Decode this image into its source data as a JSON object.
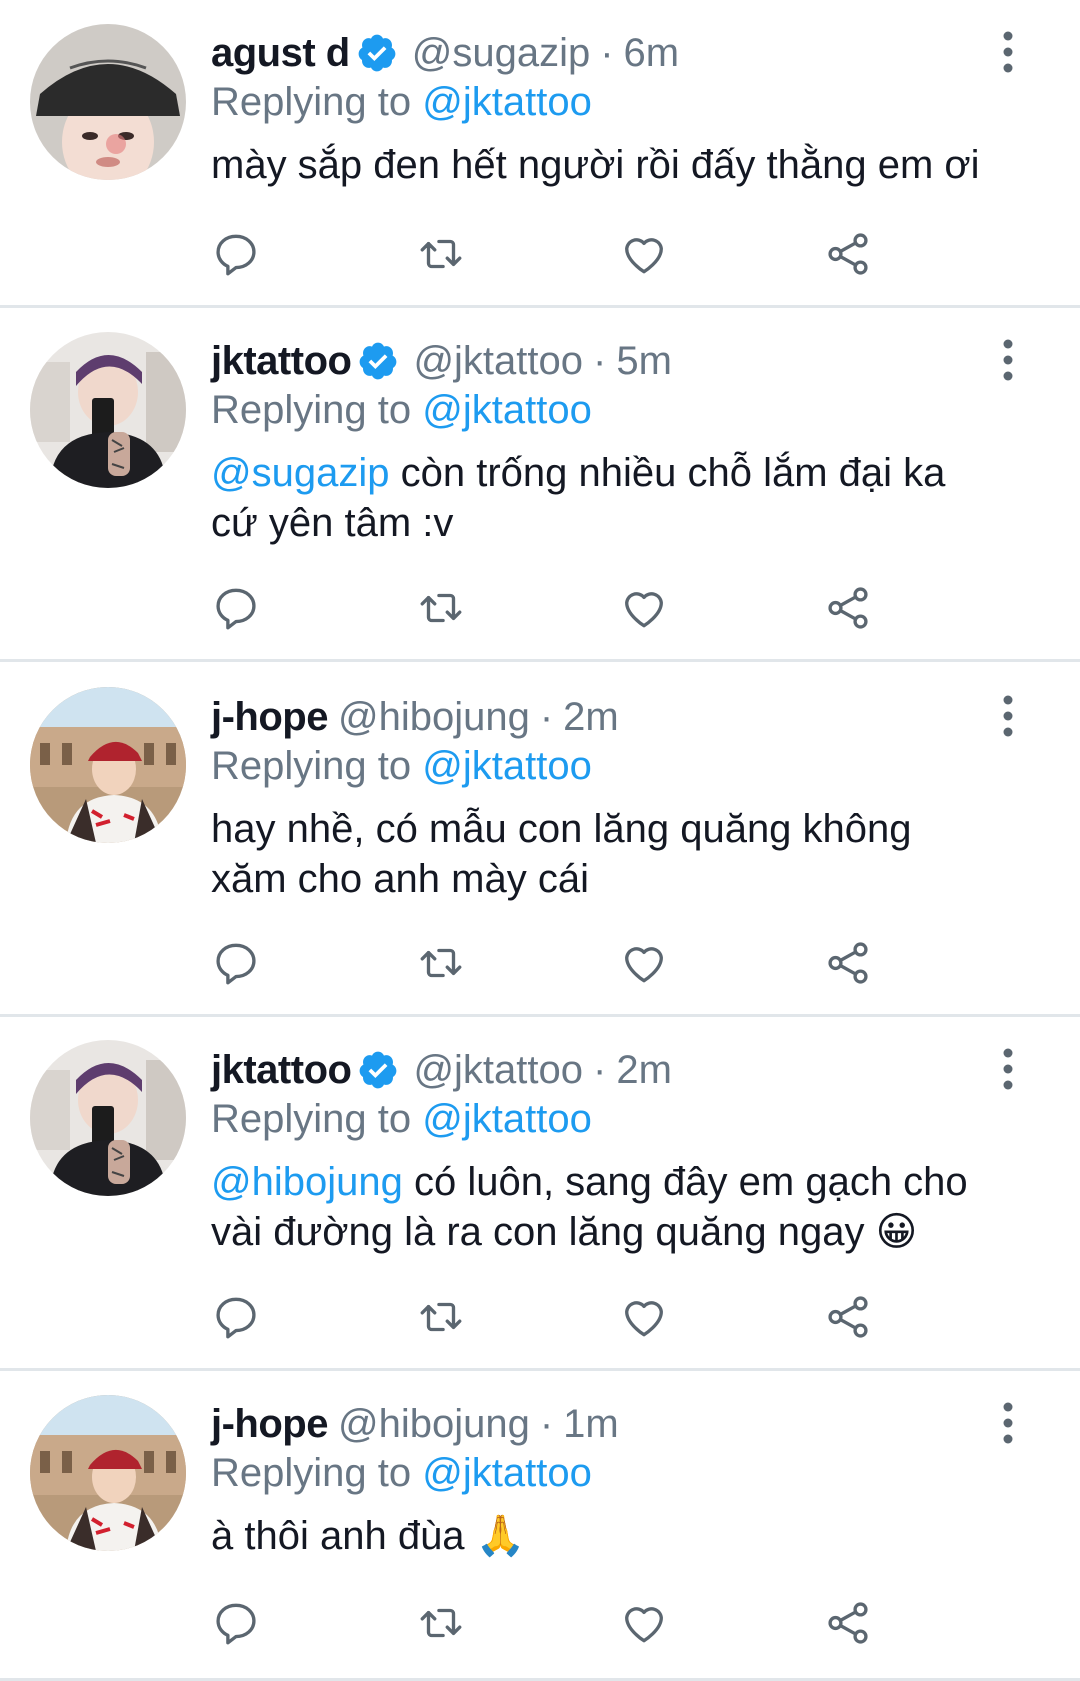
{
  "tweets": [
    {
      "name": "agust d",
      "verified": true,
      "handle": "@sugazip",
      "time": "6m",
      "replying_prefix": "Replying to",
      "replying_to": "@jktattoo",
      "mention": "",
      "text": "mày sắp đen hết người rồi đấy thằng em ơi",
      "avatar_icon": "person-in-black-cap-avatar"
    },
    {
      "name": "jktattoo",
      "verified": true,
      "handle": "@jktattoo",
      "time": "5m",
      "replying_prefix": "Replying to",
      "replying_to": "@jktattoo",
      "mention": "@sugazip",
      "text": " còn trống nhiều chỗ lắm đại ka\ncứ yên tâm :v",
      "avatar_icon": "mirror-selfie-avatar"
    },
    {
      "name": "j-hope",
      "verified": false,
      "handle": "@hibojung",
      "time": "2m",
      "replying_prefix": "Replying to",
      "replying_to": "@jktattoo",
      "mention": "",
      "text": "hay nhề, có mẫu con lăng quăng không\nxăm cho anh mày cái",
      "avatar_icon": "person-in-red-cap-avatar"
    },
    {
      "name": "jktattoo",
      "verified": true,
      "handle": "@jktattoo",
      "time": "2m",
      "replying_prefix": "Replying to",
      "replying_to": "@jktattoo",
      "mention": "@hibojung",
      "text": " có luôn, sang đây em gạch cho\nvài đường là ra con lăng quăng ngay 😀",
      "avatar_icon": "mirror-selfie-avatar"
    },
    {
      "name": "j-hope",
      "verified": false,
      "handle": "@hibojung",
      "time": "1m",
      "replying_prefix": "Replying to",
      "replying_to": "@jktattoo",
      "mention": "",
      "text": "à thôi anh đùa 🙏",
      "avatar_icon": "person-in-red-cap-avatar"
    }
  ],
  "icons": {
    "reply": "reply-icon",
    "retweet": "retweet-icon",
    "like": "heart-icon",
    "share": "share-icon",
    "more": "more-options-icon",
    "verified": "verified-badge-icon"
  },
  "colors": {
    "accent": "#1d9bf0",
    "muted": "#687684",
    "text": "#141823",
    "divider": "#e1e6ea"
  }
}
